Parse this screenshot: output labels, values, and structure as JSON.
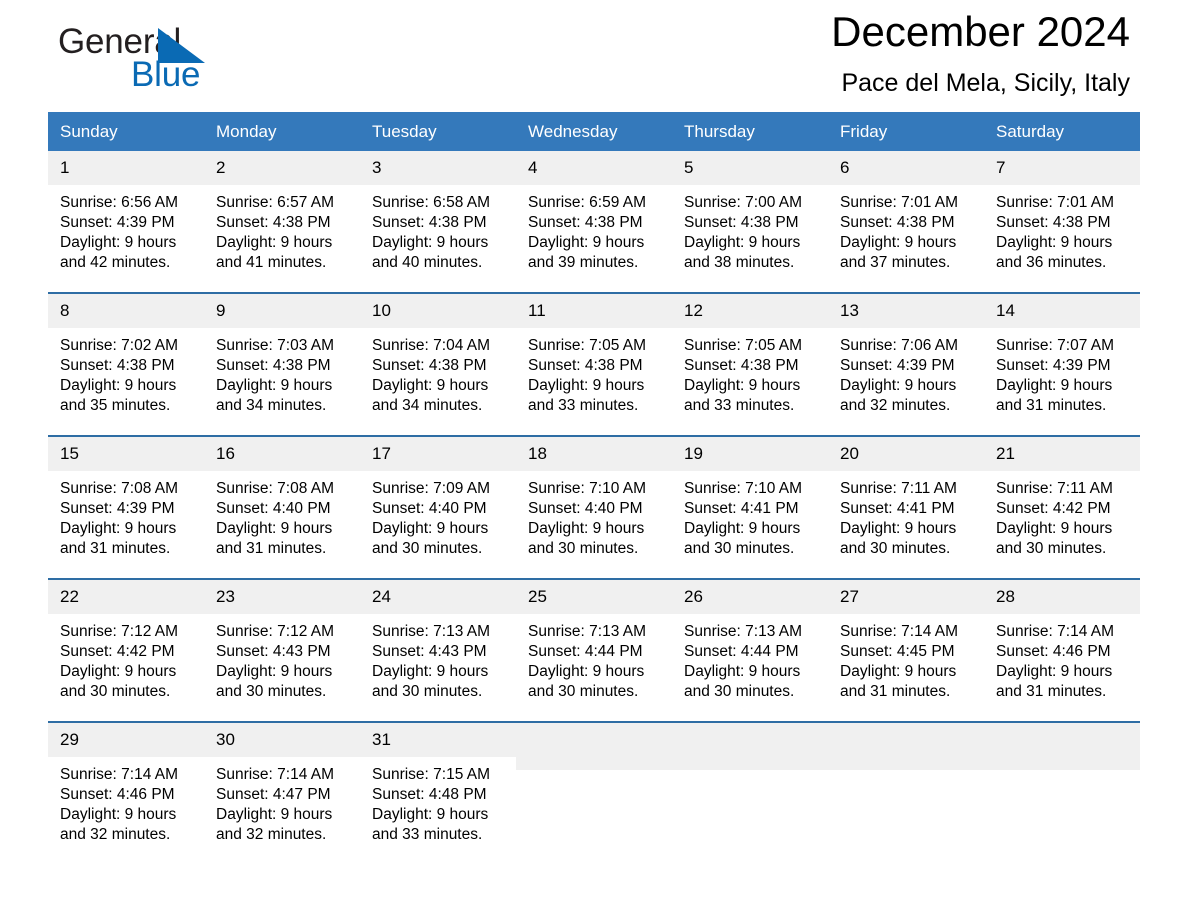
{
  "logo": {
    "word1": "General",
    "word2": "Blue",
    "triangle_color": "#0a6ab4",
    "text_color": "#231f20"
  },
  "header": {
    "month_title": "December 2024",
    "location": "Pace del Mela, Sicily, Italy"
  },
  "theme": {
    "header_bg": "#3479bb",
    "header_text": "#ffffff",
    "week_border": "#2e6da4",
    "daynum_bg": "#f0f0f0",
    "page_bg": "#ffffff"
  },
  "weekday_headers": [
    "Sunday",
    "Monday",
    "Tuesday",
    "Wednesday",
    "Thursday",
    "Friday",
    "Saturday"
  ],
  "weeks": [
    [
      {
        "day": "1",
        "sunrise": "Sunrise: 6:56 AM",
        "sunset": "Sunset: 4:39 PM",
        "daylight1": "Daylight: 9 hours",
        "daylight2": "and 42 minutes."
      },
      {
        "day": "2",
        "sunrise": "Sunrise: 6:57 AM",
        "sunset": "Sunset: 4:38 PM",
        "daylight1": "Daylight: 9 hours",
        "daylight2": "and 41 minutes."
      },
      {
        "day": "3",
        "sunrise": "Sunrise: 6:58 AM",
        "sunset": "Sunset: 4:38 PM",
        "daylight1": "Daylight: 9 hours",
        "daylight2": "and 40 minutes."
      },
      {
        "day": "4",
        "sunrise": "Sunrise: 6:59 AM",
        "sunset": "Sunset: 4:38 PM",
        "daylight1": "Daylight: 9 hours",
        "daylight2": "and 39 minutes."
      },
      {
        "day": "5",
        "sunrise": "Sunrise: 7:00 AM",
        "sunset": "Sunset: 4:38 PM",
        "daylight1": "Daylight: 9 hours",
        "daylight2": "and 38 minutes."
      },
      {
        "day": "6",
        "sunrise": "Sunrise: 7:01 AM",
        "sunset": "Sunset: 4:38 PM",
        "daylight1": "Daylight: 9 hours",
        "daylight2": "and 37 minutes."
      },
      {
        "day": "7",
        "sunrise": "Sunrise: 7:01 AM",
        "sunset": "Sunset: 4:38 PM",
        "daylight1": "Daylight: 9 hours",
        "daylight2": "and 36 minutes."
      }
    ],
    [
      {
        "day": "8",
        "sunrise": "Sunrise: 7:02 AM",
        "sunset": "Sunset: 4:38 PM",
        "daylight1": "Daylight: 9 hours",
        "daylight2": "and 35 minutes."
      },
      {
        "day": "9",
        "sunrise": "Sunrise: 7:03 AM",
        "sunset": "Sunset: 4:38 PM",
        "daylight1": "Daylight: 9 hours",
        "daylight2": "and 34 minutes."
      },
      {
        "day": "10",
        "sunrise": "Sunrise: 7:04 AM",
        "sunset": "Sunset: 4:38 PM",
        "daylight1": "Daylight: 9 hours",
        "daylight2": "and 34 minutes."
      },
      {
        "day": "11",
        "sunrise": "Sunrise: 7:05 AM",
        "sunset": "Sunset: 4:38 PM",
        "daylight1": "Daylight: 9 hours",
        "daylight2": "and 33 minutes."
      },
      {
        "day": "12",
        "sunrise": "Sunrise: 7:05 AM",
        "sunset": "Sunset: 4:38 PM",
        "daylight1": "Daylight: 9 hours",
        "daylight2": "and 33 minutes."
      },
      {
        "day": "13",
        "sunrise": "Sunrise: 7:06 AM",
        "sunset": "Sunset: 4:39 PM",
        "daylight1": "Daylight: 9 hours",
        "daylight2": "and 32 minutes."
      },
      {
        "day": "14",
        "sunrise": "Sunrise: 7:07 AM",
        "sunset": "Sunset: 4:39 PM",
        "daylight1": "Daylight: 9 hours",
        "daylight2": "and 31 minutes."
      }
    ],
    [
      {
        "day": "15",
        "sunrise": "Sunrise: 7:08 AM",
        "sunset": "Sunset: 4:39 PM",
        "daylight1": "Daylight: 9 hours",
        "daylight2": "and 31 minutes."
      },
      {
        "day": "16",
        "sunrise": "Sunrise: 7:08 AM",
        "sunset": "Sunset: 4:40 PM",
        "daylight1": "Daylight: 9 hours",
        "daylight2": "and 31 minutes."
      },
      {
        "day": "17",
        "sunrise": "Sunrise: 7:09 AM",
        "sunset": "Sunset: 4:40 PM",
        "daylight1": "Daylight: 9 hours",
        "daylight2": "and 30 minutes."
      },
      {
        "day": "18",
        "sunrise": "Sunrise: 7:10 AM",
        "sunset": "Sunset: 4:40 PM",
        "daylight1": "Daylight: 9 hours",
        "daylight2": "and 30 minutes."
      },
      {
        "day": "19",
        "sunrise": "Sunrise: 7:10 AM",
        "sunset": "Sunset: 4:41 PM",
        "daylight1": "Daylight: 9 hours",
        "daylight2": "and 30 minutes."
      },
      {
        "day": "20",
        "sunrise": "Sunrise: 7:11 AM",
        "sunset": "Sunset: 4:41 PM",
        "daylight1": "Daylight: 9 hours",
        "daylight2": "and 30 minutes."
      },
      {
        "day": "21",
        "sunrise": "Sunrise: 7:11 AM",
        "sunset": "Sunset: 4:42 PM",
        "daylight1": "Daylight: 9 hours",
        "daylight2": "and 30 minutes."
      }
    ],
    [
      {
        "day": "22",
        "sunrise": "Sunrise: 7:12 AM",
        "sunset": "Sunset: 4:42 PM",
        "daylight1": "Daylight: 9 hours",
        "daylight2": "and 30 minutes."
      },
      {
        "day": "23",
        "sunrise": "Sunrise: 7:12 AM",
        "sunset": "Sunset: 4:43 PM",
        "daylight1": "Daylight: 9 hours",
        "daylight2": "and 30 minutes."
      },
      {
        "day": "24",
        "sunrise": "Sunrise: 7:13 AM",
        "sunset": "Sunset: 4:43 PM",
        "daylight1": "Daylight: 9 hours",
        "daylight2": "and 30 minutes."
      },
      {
        "day": "25",
        "sunrise": "Sunrise: 7:13 AM",
        "sunset": "Sunset: 4:44 PM",
        "daylight1": "Daylight: 9 hours",
        "daylight2": "and 30 minutes."
      },
      {
        "day": "26",
        "sunrise": "Sunrise: 7:13 AM",
        "sunset": "Sunset: 4:44 PM",
        "daylight1": "Daylight: 9 hours",
        "daylight2": "and 30 minutes."
      },
      {
        "day": "27",
        "sunrise": "Sunrise: 7:14 AM",
        "sunset": "Sunset: 4:45 PM",
        "daylight1": "Daylight: 9 hours",
        "daylight2": "and 31 minutes."
      },
      {
        "day": "28",
        "sunrise": "Sunrise: 7:14 AM",
        "sunset": "Sunset: 4:46 PM",
        "daylight1": "Daylight: 9 hours",
        "daylight2": "and 31 minutes."
      }
    ],
    [
      {
        "day": "29",
        "sunrise": "Sunrise: 7:14 AM",
        "sunset": "Sunset: 4:46 PM",
        "daylight1": "Daylight: 9 hours",
        "daylight2": "and 32 minutes."
      },
      {
        "day": "30",
        "sunrise": "Sunrise: 7:14 AM",
        "sunset": "Sunset: 4:47 PM",
        "daylight1": "Daylight: 9 hours",
        "daylight2": "and 32 minutes."
      },
      {
        "day": "31",
        "sunrise": "Sunrise: 7:15 AM",
        "sunset": "Sunset: 4:48 PM",
        "daylight1": "Daylight: 9 hours",
        "daylight2": "and 33 minutes."
      },
      {
        "day": "",
        "sunrise": "",
        "sunset": "",
        "daylight1": "",
        "daylight2": ""
      },
      {
        "day": "",
        "sunrise": "",
        "sunset": "",
        "daylight1": "",
        "daylight2": ""
      },
      {
        "day": "",
        "sunrise": "",
        "sunset": "",
        "daylight1": "",
        "daylight2": ""
      },
      {
        "day": "",
        "sunrise": "",
        "sunset": "",
        "daylight1": "",
        "daylight2": ""
      }
    ]
  ]
}
